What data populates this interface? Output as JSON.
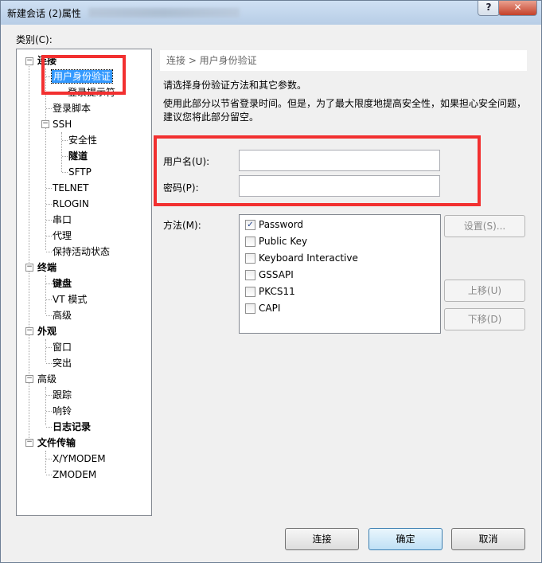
{
  "window": {
    "title": "新建会话 (2)属性",
    "help_glyph": "?",
    "close_glyph": "✕"
  },
  "category_label": "类别(C):",
  "tree": {
    "connection": "连接",
    "user_auth": "用户身份验证",
    "login_prompt": "登录提示符",
    "login_script": "登录脚本",
    "ssh": "SSH",
    "security": "安全性",
    "tunnel": "隧道",
    "sftp": "SFTP",
    "telnet": "TELNET",
    "rlogin": "RLOGIN",
    "serial": "串口",
    "proxy": "代理",
    "keepalive": "保持活动状态",
    "terminal": "终端",
    "keyboard": "键盘",
    "vt_mode": "VT 模式",
    "advanced_term": "高级",
    "appearance": "外观",
    "window": "窗口",
    "highlight": "突出",
    "advanced": "高级",
    "trace": "跟踪",
    "bell": "响铃",
    "logging": "日志记录",
    "file_transfer": "文件传输",
    "xymodem": "X/YMODEM",
    "zmodem": "ZMODEM",
    "expand_glyph": "−"
  },
  "panel": {
    "breadcrumb": "连接 > 用户身份验证",
    "intro1": "请选择身份验证方法和其它参数。",
    "intro2": "使用此部分以节省登录时间。但是，为了最大限度地提高安全性，如果担心安全问题，建议您将此部分留空。",
    "username_label": "用户名(U):",
    "username_value": "",
    "password_label": "密码(P):",
    "password_value": "",
    "method_label": "方法(M):"
  },
  "methods": [
    {
      "label": "Password",
      "checked": true
    },
    {
      "label": "Public Key",
      "checked": false
    },
    {
      "label": "Keyboard Interactive",
      "checked": false
    },
    {
      "label": "GSSAPI",
      "checked": false
    },
    {
      "label": "PKCS11",
      "checked": false
    },
    {
      "label": "CAPI",
      "checked": false
    }
  ],
  "check_glyph": "✓",
  "side_buttons": {
    "settings": "设置(S)...",
    "move_up": "上移(U)",
    "move_down": "下移(D)"
  },
  "footer": {
    "connect": "连接",
    "ok": "确定",
    "cancel": "取消"
  },
  "colors": {
    "selection": "#3399ff",
    "annotation_red": "#f23030"
  }
}
